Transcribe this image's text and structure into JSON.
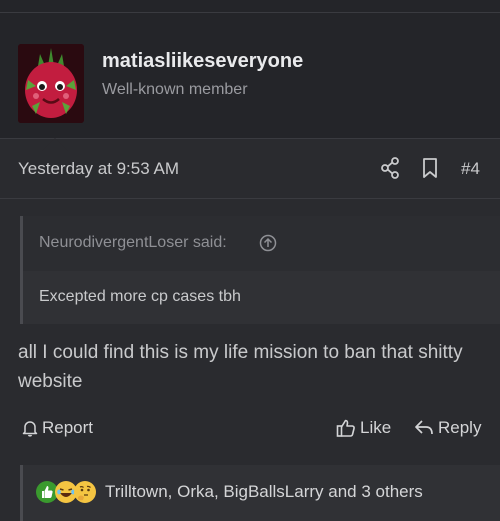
{
  "post": {
    "username": "matiasliikeseveryone",
    "user_title": "Well-known member",
    "timestamp": "Yesterday at 9:53 AM",
    "post_number": "#4",
    "quote": {
      "author": "NeurodivergentLoser said:",
      "text": "Excepted more cp cases tbh"
    },
    "message": "all I could find this is my life mission to ban that shitty website"
  },
  "actions": {
    "report_label": "Report",
    "like_label": "Like",
    "reply_label": "Reply"
  },
  "reactions": {
    "icons": [
      "like-icon",
      "laugh-icon",
      "thinking-icon"
    ],
    "summary": "Trilltown, Orka, BigBallsLarry and 3 others"
  }
}
